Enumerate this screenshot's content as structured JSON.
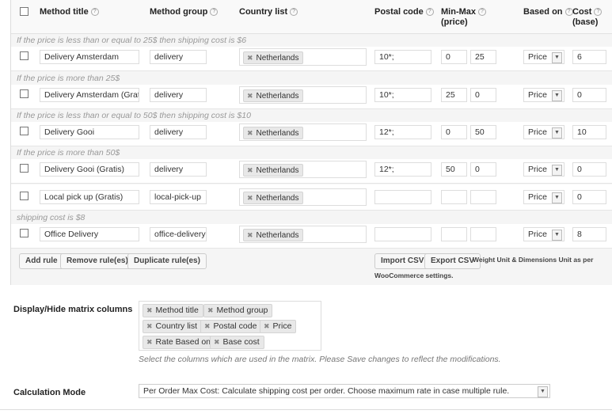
{
  "headers": {
    "method_title": "Method title",
    "method_group": "Method group",
    "country_list": "Country list",
    "postal_code": "Postal code",
    "min_max_1": "Min-Max",
    "min_max_2": "(price)",
    "based_on": "Based on",
    "cost_1": "Cost",
    "cost_2": "(base)"
  },
  "rows": [
    {
      "note": "If the price is less than or equal to 25$ then shipping cost is $6",
      "title": "Delivery Amsterdam",
      "group": "delivery",
      "country": "Netherlands",
      "postal": "10*;",
      "min": "0",
      "max": "25",
      "based": "Price",
      "cost": "6"
    },
    {
      "note": "If the price is more than 25$",
      "title": "Delivery Amsterdam (Gratis",
      "group": "delivery",
      "country": "Netherlands",
      "postal": "10*;",
      "min": "25",
      "max": "0",
      "based": "Price",
      "cost": "0"
    },
    {
      "note": "If the price is less than or equal to 50$ then shipping cost is $10",
      "title": "Delivery Gooi",
      "group": "delivery",
      "country": "Netherlands",
      "postal": "12*;",
      "min": "0",
      "max": "50",
      "based": "Price",
      "cost": "10"
    },
    {
      "note": "If the price is more than 50$",
      "title": "Delivery Gooi (Gratis)",
      "group": "delivery",
      "country": "Netherlands",
      "postal": "12*;",
      "min": "50",
      "max": "0",
      "based": "Price",
      "cost": "0"
    },
    {
      "note": "",
      "title": "Local pick up (Gratis)",
      "group": "local-pick-up",
      "country": "Netherlands",
      "postal": "",
      "min": "",
      "max": "",
      "based": "Price",
      "cost": "0"
    },
    {
      "note": "shipping cost is $8",
      "title": "Office Delivery",
      "group": "office-delivery",
      "country": "Netherlands",
      "postal": "",
      "min": "",
      "max": "",
      "based": "Price",
      "cost": "8"
    }
  ],
  "buttons": {
    "add_rule": "Add rule",
    "remove_rules": "Remove rule(es)",
    "duplicate_rules": "Duplicate rule(es)",
    "import_csv": "Import CSV",
    "export_csv": "Export CSV"
  },
  "units_note_1": "Weight Unit & Dimensions Unit as per",
  "units_note_2": "WooCommerce settings.",
  "display_hide": {
    "label": "Display/Hide matrix columns",
    "chips": [
      "Method title",
      "Method group",
      "Country list",
      "Postal code",
      "Price",
      "Rate Based on",
      "Base cost"
    ],
    "description": "Select the columns which are used in the matrix. Please Save changes to reflect the modifications."
  },
  "calculation": {
    "label": "Calculation Mode",
    "value": "Per Order Max Cost: Calculate shipping cost per order. Choose maximum rate in case multiple rule."
  }
}
